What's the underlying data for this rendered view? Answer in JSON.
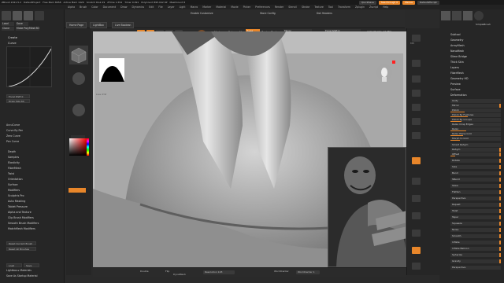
{
  "title_bar": {
    "items": [
      "ZBrush 2021.5.2",
      "DefaultProject",
      "Free Mem 8958",
      "Active Mem 1429",
      "Scratch Disk 29",
      "ZTime 1.554",
      "Timer 0.091",
      "PolyCount 895.042 KP",
      "MeshCount 8"
    ],
    "right": {
      "quicksave": "QuickSave",
      "see_through": "See-through 0",
      "menus": "Menus",
      "script": "DefaultZScript"
    }
  },
  "menu_bar": [
    "Alpha",
    "Brush",
    "Color",
    "Document",
    "Draw",
    "Dynamics",
    "Edit",
    "File",
    "Layer",
    "Light",
    "Macro",
    "Marker",
    "Material",
    "Movie",
    "Picker",
    "Preferences",
    "Render",
    "Stencil",
    "Stroke",
    "Texture",
    "Tool",
    "Transform",
    "Zplugin",
    "Zscript",
    "Help"
  ],
  "left_panel": {
    "top_buttons": [
      "Load",
      "Save",
      "Clone",
      "Make PolyMesh3D",
      "Goz",
      "All",
      "Visible"
    ],
    "lightbox_label": "Lightbox ▸ Tools",
    "section_create": "Create",
    "curve_label": "Curve",
    "focal": "Focal Shift 0",
    "draw": "Draw Size 64",
    "menu_items": [
      "AccuCurve",
      "Curve By Pen",
      "Zero Curve",
      "Pen Curve"
    ],
    "list": [
      "Depth",
      "Samples",
      "Elasticity",
      "FiberMesh",
      "Twist",
      "Orientation",
      "Surface",
      "Modifiers",
      "Sculptris Pro",
      "Auto Masking",
      "Tablet Pressure",
      "Alpha and Texture",
      "Clip Brush Modifiers",
      "Smooth Brush Modifiers",
      "MatchMesh Modifiers"
    ],
    "reset_btns": [
      "Reset Current Brush",
      "Reset All Brushes"
    ],
    "bottom": [
      "Load",
      "Save",
      "Lightbox ▸ Materials",
      "Save As Startup Material"
    ]
  },
  "shelf": {
    "home": "Home Page",
    "lightbox": "LightBox",
    "live_boolean": "Live Boolean",
    "tools": [
      "Edit",
      "Draw",
      "Move",
      "Scale",
      "Rotate"
    ],
    "mrgb": "Mrgb",
    "rgb": "Rgb",
    "m": "M",
    "zadd": "Zadd",
    "zsub": "Zsub",
    "zcut": "Zcut",
    "rgb_intensity": "Rgb Intensity 100",
    "z_intensity": "Z Intensity 8",
    "focal_shift": "Focal Shift 0",
    "draw_size": "Draw Size 64",
    "dynamic": "Dynamic",
    "mirror": "Mirror",
    "enable_customize": "Enable Customize",
    "store_config": "Store Config",
    "dot_headers": "Dot Headers",
    "active_points": "ActivePoints: 12.384",
    "total_points": "TotalPoints: 1.254 Mil"
  },
  "viewport": {
    "overlay_label": "Live XYZ"
  },
  "tool_strip": {
    "labels": [
      "Standard",
      "Move",
      "ClayBuildup",
      "hPolish",
      "Dam_Standard",
      "Inflat"
    ]
  },
  "bottom_bar": {
    "doubles": "Double",
    "flip": "Flip",
    "dynamesh": "DynaMesh",
    "resolution": "Resolution 128",
    "worldcenter": "WorldCenter 1",
    "wcm": "WorldCenter"
  },
  "right_tools": {
    "labels": [
      "BPR",
      "Persp",
      "Floor",
      "Local",
      "L.Sym",
      "Xyz",
      "Frame",
      "Move",
      "Scale",
      "Rotate",
      "PolyF",
      "Transp",
      "Solo"
    ]
  },
  "right_panel": {
    "top_label": "SimpleBrush",
    "items": [
      "Subtool",
      "Geometry",
      "ArrayMesh",
      "NanoMesh",
      "Slime Bridge",
      "Thick Skin",
      "Layers",
      "FiberMesh",
      "Geometry HD",
      "Preview",
      "Surface",
      "Deformation"
    ],
    "deform_items": [
      "Unify",
      "Mirror",
      "Polish",
      "Polish By Features",
      "Polish By Groups",
      "Relax Crisp Edges",
      "Relax",
      "Relax Plane Grid",
      "Morph to Grid",
      "Smart ReSym",
      "ReSym",
      "Offset",
      "Rotate",
      "Size",
      "Bend",
      "SBend",
      "Skew",
      "Flatten",
      "Perspective",
      "Repeat",
      "Twist",
      "Taper",
      "Squeeze",
      "Noise",
      "Smooth",
      "Inflate",
      "Inflate Balloon",
      "Spherize",
      "Gravity",
      "Perspective"
    ]
  },
  "colors": {
    "accent": "#e8862a",
    "bg": "#262626",
    "viewport": "#bdbdbd",
    "red_marker": "#ff2020"
  }
}
